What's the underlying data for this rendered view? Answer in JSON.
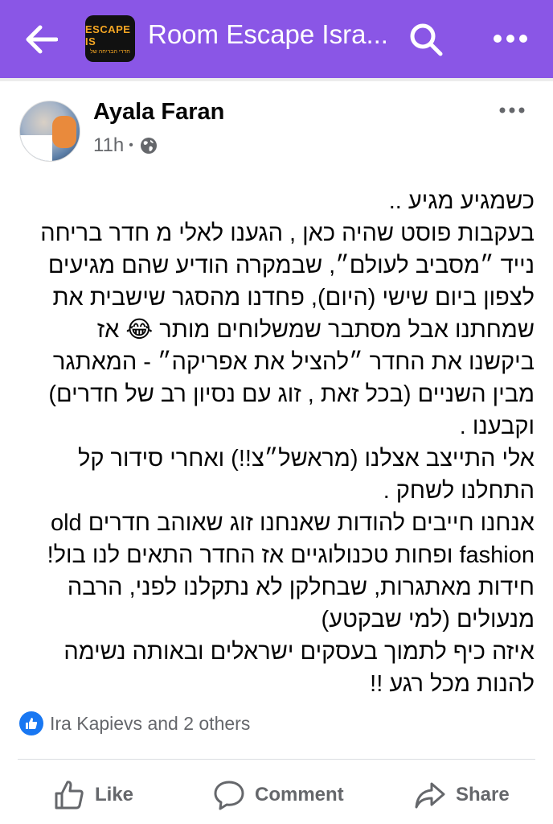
{
  "header": {
    "group_title": "Room Escape Isra...",
    "logo_text_main": "ESCAPE IS",
    "logo_text_sub": "חדרי הבריחה של",
    "icons": [
      "back-arrow-icon",
      "search-icon",
      "more-icon"
    ],
    "background_color": "#8a56e6"
  },
  "post": {
    "author": "Ayala Faran",
    "time": "11h",
    "audience_icon": "globe-icon",
    "lines": [
      "כשמגיע מגיע ..",
      "בעקבות פוסט שהיה כאן , הגענו לאלי מ חדר בריחה",
      "נייד ״מסביב לעולם״, שבמקרה הודיע שהם מגיעים",
      "לצפון ביום שישי (היום), פחדנו מהסגר שישבית את",
      "שמחתנו אבל מסתבר שמשלוחים מותר 😂 אז",
      "ביקשנו את החדר ״להציל את אפריקה״ - המאתגר",
      "מבין השניים (בכל זאת , זוג עם נסיון רב של חדרים)",
      "וקבענו .",
      "אלי התייצב אצלנו (מראשל״צ!!) ואחרי סידור קל",
      "התחלנו לשחק .",
      "אנחנו חייבים להודות שאנחנו זוג שאוהב חדרים old",
      "fashion ופחות טכנולוגיים אז החדר התאים לנו בול!",
      "חידות מאתגרות, שבחלקן לא נתקלנו לפני, הרבה",
      "מנעולים (למי שבקטע)",
      "איזה כיף לתמוך בעסקים ישראלים ובאותה נשימה",
      "להנות מכל רגע !!"
    ]
  },
  "reactions": {
    "text": "Ira Kapievs and 2 others",
    "icon": "like-reaction-icon",
    "color": "#1877f2"
  },
  "actions": {
    "like": "Like",
    "comment": "Comment",
    "share": "Share"
  }
}
